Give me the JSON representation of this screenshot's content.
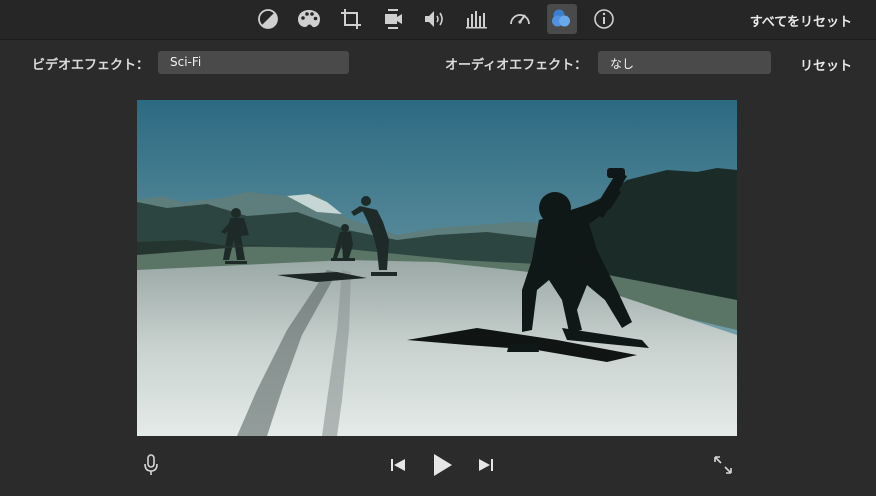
{
  "toolbar": {
    "tools": [
      {
        "name": "color-balance-icon"
      },
      {
        "name": "color-correction-icon"
      },
      {
        "name": "crop-icon"
      },
      {
        "name": "stabilization-icon"
      },
      {
        "name": "volume-icon"
      },
      {
        "name": "equalizer-icon"
      },
      {
        "name": "speed-icon"
      },
      {
        "name": "clip-filter-icon",
        "active": true
      },
      {
        "name": "info-icon"
      }
    ],
    "reset_all_label": "すべてをリセット"
  },
  "effects": {
    "video_label": "ビデオエフェクト：",
    "video_value": "Sci-Fi",
    "audio_label": "オーディオエフェクト：",
    "audio_value": "なし",
    "reset_label": "リセット"
  },
  "viewer": {
    "icons": [
      "microphone-icon",
      "skip-back-icon",
      "play-icon",
      "skip-forward-icon",
      "fullscreen-icon"
    ]
  },
  "colors": {
    "background": "#2b2b2b",
    "toolbar": "#262626",
    "field": "#4a4a4a",
    "accent_blue": "#3f86d9",
    "sky": "#2f6f86"
  }
}
